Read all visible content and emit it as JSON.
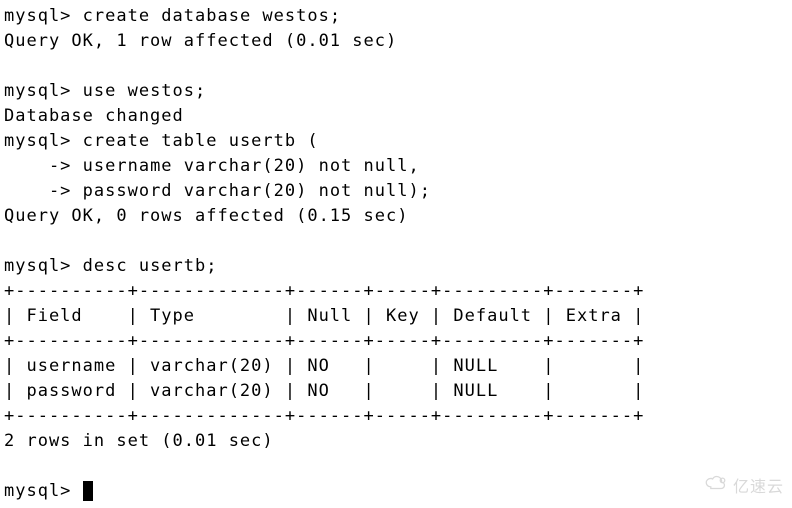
{
  "prompt": "mysql> ",
  "cont_prompt": "    -> ",
  "cmd_create_db": "create database westos;",
  "resp_create_db": "Query OK, 1 row affected (0.01 sec)",
  "cmd_use": "use westos;",
  "resp_use": "Database changed",
  "cmd_create_table": "create table usertb (",
  "cmd_create_table_l1": "username varchar(20) not null,",
  "cmd_create_table_l2": "password varchar(20) not null);",
  "resp_create_table": "Query OK, 0 rows affected (0.15 sec)",
  "cmd_desc": "desc usertb;",
  "table_border": "+----------+-------------+------+-----+---------+-------+",
  "table_header": "| Field    | Type        | Null | Key | Default | Extra |",
  "table_rows": [
    "| username | varchar(20) | NO   |     | NULL    |       |",
    "| password | varchar(20) | NO   |     | NULL    |       |"
  ],
  "table_footer": "2 rows in set (0.01 sec)",
  "watermark_text": "亿速云",
  "chart_data": {
    "type": "table",
    "title": "desc usertb",
    "columns": [
      "Field",
      "Type",
      "Null",
      "Key",
      "Default",
      "Extra"
    ],
    "rows": [
      {
        "Field": "username",
        "Type": "varchar(20)",
        "Null": "NO",
        "Key": "",
        "Default": "NULL",
        "Extra": ""
      },
      {
        "Field": "password",
        "Type": "varchar(20)",
        "Null": "NO",
        "Key": "",
        "Default": "NULL",
        "Extra": ""
      }
    ]
  }
}
